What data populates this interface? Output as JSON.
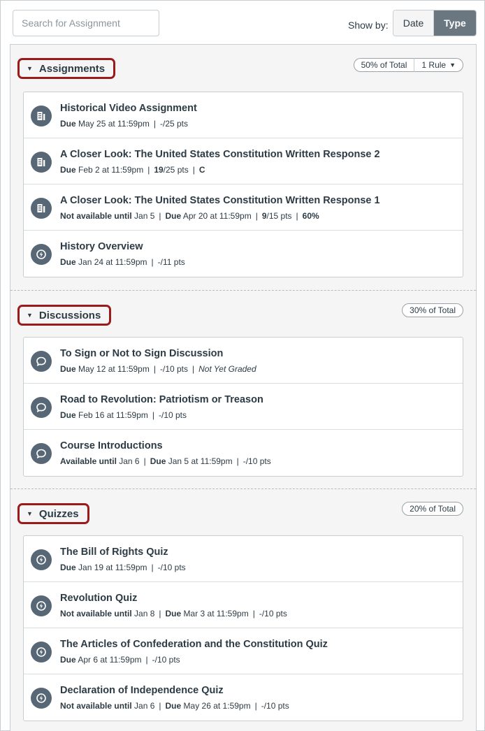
{
  "search": {
    "placeholder": "Search for Assignment"
  },
  "show_by": {
    "label": "Show by:",
    "options": [
      "Date",
      "Type"
    ],
    "selected": "Type"
  },
  "groups": [
    {
      "name": "Assignments",
      "weight": "50% of Total",
      "rule": "1 Rule",
      "items": [
        {
          "icon": "assignment-icon",
          "title": "Historical Video Assignment",
          "due_label": "Due",
          "due_date": "May 25 at 11:59pm",
          "score": "-/25 pts"
        },
        {
          "icon": "assignment-icon",
          "title": "A Closer Look: The United States Constitution Written Response 2",
          "due_label": "Due",
          "due_date": "Feb 2 at 11:59pm",
          "score_earned": "19",
          "score_total": "/25 pts",
          "grade": "C"
        },
        {
          "icon": "assignment-icon",
          "title": "A Closer Look: The United States Constitution Written Response 1",
          "avail_label": "Not available until",
          "avail_date": "Jan 5",
          "due_label": "Due",
          "due_date": "Apr 20 at 11:59pm",
          "score_earned": "9",
          "score_total": "/15 pts",
          "grade": "60%"
        },
        {
          "icon": "quiz-icon",
          "title": "History Overview",
          "due_label": "Due",
          "due_date": "Jan 24 at 11:59pm",
          "score": "-/11 pts"
        }
      ]
    },
    {
      "name": "Discussions",
      "weight": "30% of Total",
      "items": [
        {
          "icon": "discussion-icon",
          "title": "To Sign or Not to Sign Discussion",
          "due_label": "Due",
          "due_date": "May 12 at 11:59pm",
          "score": "-/10 pts",
          "status": "Not Yet Graded"
        },
        {
          "icon": "discussion-icon",
          "title": "Road to Revolution: Patriotism or Treason",
          "due_label": "Due",
          "due_date": "Feb 16 at 11:59pm",
          "score": "-/10 pts"
        },
        {
          "icon": "discussion-icon",
          "title": "Course Introductions",
          "avail_label": "Available until",
          "avail_date": "Jan 6",
          "due_label": "Due",
          "due_date": "Jan 5 at 11:59pm",
          "score": "-/10 pts"
        }
      ]
    },
    {
      "name": "Quizzes",
      "weight": "20% of Total",
      "items": [
        {
          "icon": "quiz-icon",
          "title": "The Bill of Rights Quiz",
          "due_label": "Due",
          "due_date": "Jan 19 at 11:59pm",
          "score": "-/10 pts"
        },
        {
          "icon": "quiz-icon",
          "title": "Revolution Quiz",
          "avail_label": "Not available until",
          "avail_date": "Jan 8",
          "due_label": "Due",
          "due_date": "Mar 3 at 11:59pm",
          "score": "-/10 pts"
        },
        {
          "icon": "quiz-icon",
          "title": "The Articles of Confederation and the Constitution Quiz",
          "due_label": "Due",
          "due_date": "Apr 6 at 11:59pm",
          "score": "-/10 pts"
        },
        {
          "icon": "quiz-icon",
          "title": "Declaration of Independence Quiz",
          "avail_label": "Not available until",
          "avail_date": "Jan 6",
          "due_label": "Due",
          "due_date": "May 26 at 1:59pm",
          "score": "-/10 pts"
        }
      ]
    }
  ],
  "colors": {
    "text": "#2D3B45",
    "icon_bg": "#576775",
    "highlight": "#9b1b1b",
    "toggle_active": "#6b7780"
  }
}
